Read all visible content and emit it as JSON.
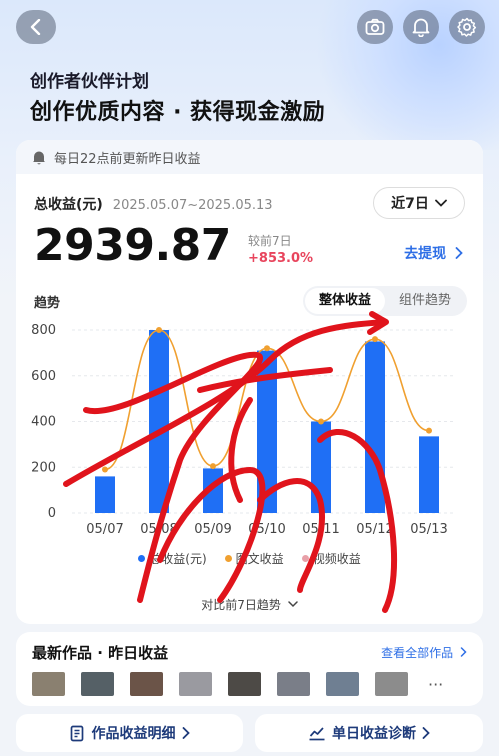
{
  "header": {
    "subtitle": "创作者伙伴计划",
    "title": "创作优质内容 · 获得现金激励"
  },
  "icons": {
    "back": "back-arrow-icon",
    "camera": "camera-icon",
    "bell": "bell-icon",
    "settings": "gear-icon"
  },
  "earnings": {
    "notice": "每日22点前更新昨日收益",
    "label": "总收益(元)",
    "date_range": "2025.05.07~2025.05.13",
    "range_selector": "近7日",
    "total": "2939.87",
    "compare_label": "较前7日",
    "compare_value": "+853.0%",
    "withdraw": "去提现"
  },
  "trend": {
    "label": "趋势",
    "tabs": [
      {
        "label": "整体收益",
        "active": true
      },
      {
        "label": "组件趋势",
        "active": false
      }
    ],
    "compare_link": "对比前7日趋势"
  },
  "chart_data": {
    "type": "bar",
    "categories": [
      "05/07",
      "05/08",
      "05/09",
      "05/10",
      "05/11",
      "05/12",
      "05/13"
    ],
    "ylim": [
      0,
      800
    ],
    "yticks": [
      0,
      200,
      400,
      600,
      800
    ],
    "series": [
      {
        "name": "总收益(元)",
        "type": "bar",
        "color": "#1f6ff5",
        "values": [
          160,
          800,
          195,
          710,
          400,
          750,
          335
        ]
      },
      {
        "name": "图文收益",
        "type": "line",
        "color": "#f0a030",
        "values": [
          190,
          800,
          205,
          720,
          400,
          760,
          360
        ]
      },
      {
        "name": "视频收益",
        "type": "line",
        "color": "#e8a0a8",
        "values": [
          0,
          0,
          0,
          0,
          0,
          0,
          0
        ]
      }
    ],
    "grid": true,
    "legend": "bottom"
  },
  "works": {
    "title": "最新作品 · 昨日收益",
    "view_all": "查看全部作品",
    "thumb_colors": [
      "#8a8070",
      "#556066",
      "#6b5448",
      "#9a9aa0",
      "#4d4a46",
      "#7a7e88",
      "#6f7f92",
      "#8c8c8c"
    ],
    "more": "···"
  },
  "buttons": {
    "detail": "作品收益明细",
    "diagnosis": "单日收益诊断"
  },
  "colors": {
    "accent": "#2f6fe6",
    "bar": "#1f6ff5",
    "line": "#f0a030",
    "increase": "#e8455d",
    "scribble": "#e0141c"
  }
}
